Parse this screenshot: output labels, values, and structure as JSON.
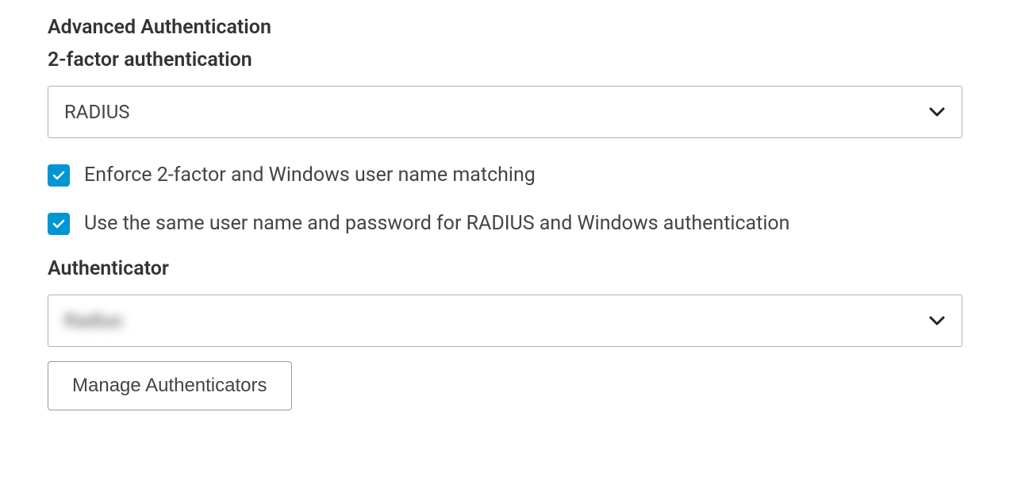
{
  "section": {
    "title": "Advanced Authentication"
  },
  "twoFactor": {
    "label": "2-factor authentication",
    "selected": "RADIUS"
  },
  "checkboxes": {
    "enforce": {
      "label": "Enforce 2-factor and Windows user name matching",
      "checked": true
    },
    "sameCreds": {
      "label": "Use the same user name and password for RADIUS and Windows authentication",
      "checked": true
    }
  },
  "authenticator": {
    "label": "Authenticator",
    "selected": "Radius"
  },
  "buttons": {
    "manage": "Manage Authenticators"
  }
}
